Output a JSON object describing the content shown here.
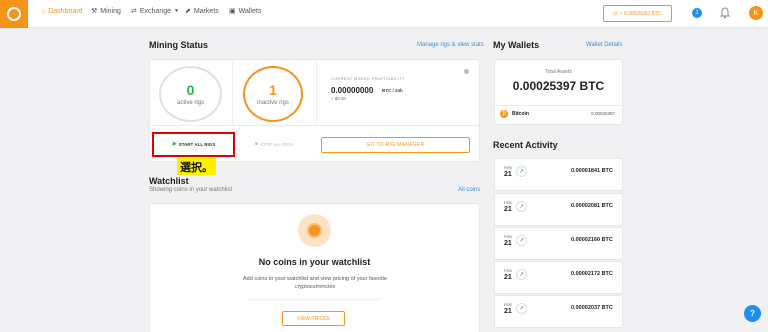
{
  "nav": {
    "items": [
      {
        "label": "Dashboard",
        "icon": "home-icon"
      },
      {
        "label": "Mining",
        "icon": "pickaxe-icon"
      },
      {
        "label": "Exchange",
        "icon": "exchange-icon"
      },
      {
        "label": "Markets",
        "icon": "chart-icon"
      },
      {
        "label": "Wallets",
        "icon": "wallet-icon"
      }
    ],
    "balance": "≈ 0.00025397 BTC",
    "notifications": "1",
    "avatar_letter": "K"
  },
  "mining": {
    "title": "Mining Status",
    "manage_link": "Manage rigs & view stats",
    "active_count": "0",
    "active_label": "active rigs",
    "inactive_count": "1",
    "inactive_label": "inactive rigs",
    "profit_label": "CURRENT MINING PROFITABILITY",
    "profit_value": "0.00000000",
    "profit_unit": "BTC / 24h",
    "profit_usd": "≈ $0.00",
    "start_label": "START ALL RIGS",
    "stop_label": "STOP ALL RIGS",
    "goto_label": "GO TO RIG MANAGER",
    "annotation": "選択。"
  },
  "watchlist": {
    "title": "Watchlist",
    "subtitle": "Showing coins in your watchlist",
    "all_coins_link": "All coins",
    "empty_title": "No coins in your watchlist",
    "empty_desc": "Add coins to your watchlist and view pricing of your favorite cryptocurrencies",
    "view_prices": "VIEW PRICES"
  },
  "wallets": {
    "title": "My Wallets",
    "details_link": "Wallet Details",
    "total_label": "Total Assets",
    "total_value": "0.00025397 BTC",
    "coin_name": "Bitcoin",
    "coin_amount": "0.00025397"
  },
  "activity": {
    "title": "Recent Activity",
    "rows": [
      {
        "month": "FEB",
        "day": "21",
        "amount": "0.00001841 BTC"
      },
      {
        "month": "FEB",
        "day": "21",
        "amount": "0.00002081 BTC"
      },
      {
        "month": "FEB",
        "day": "21",
        "amount": "0.00002160 BTC"
      },
      {
        "month": "FEB",
        "day": "21",
        "amount": "0.00002172 BTC"
      },
      {
        "month": "FEB",
        "day": "21",
        "amount": "0.00002037 BTC"
      }
    ]
  },
  "colors": {
    "accent": "#f7931a",
    "link": "#3b8fd9",
    "success": "#2fb24a",
    "highlight_box": "#e00000",
    "note_bg": "#fff000"
  }
}
